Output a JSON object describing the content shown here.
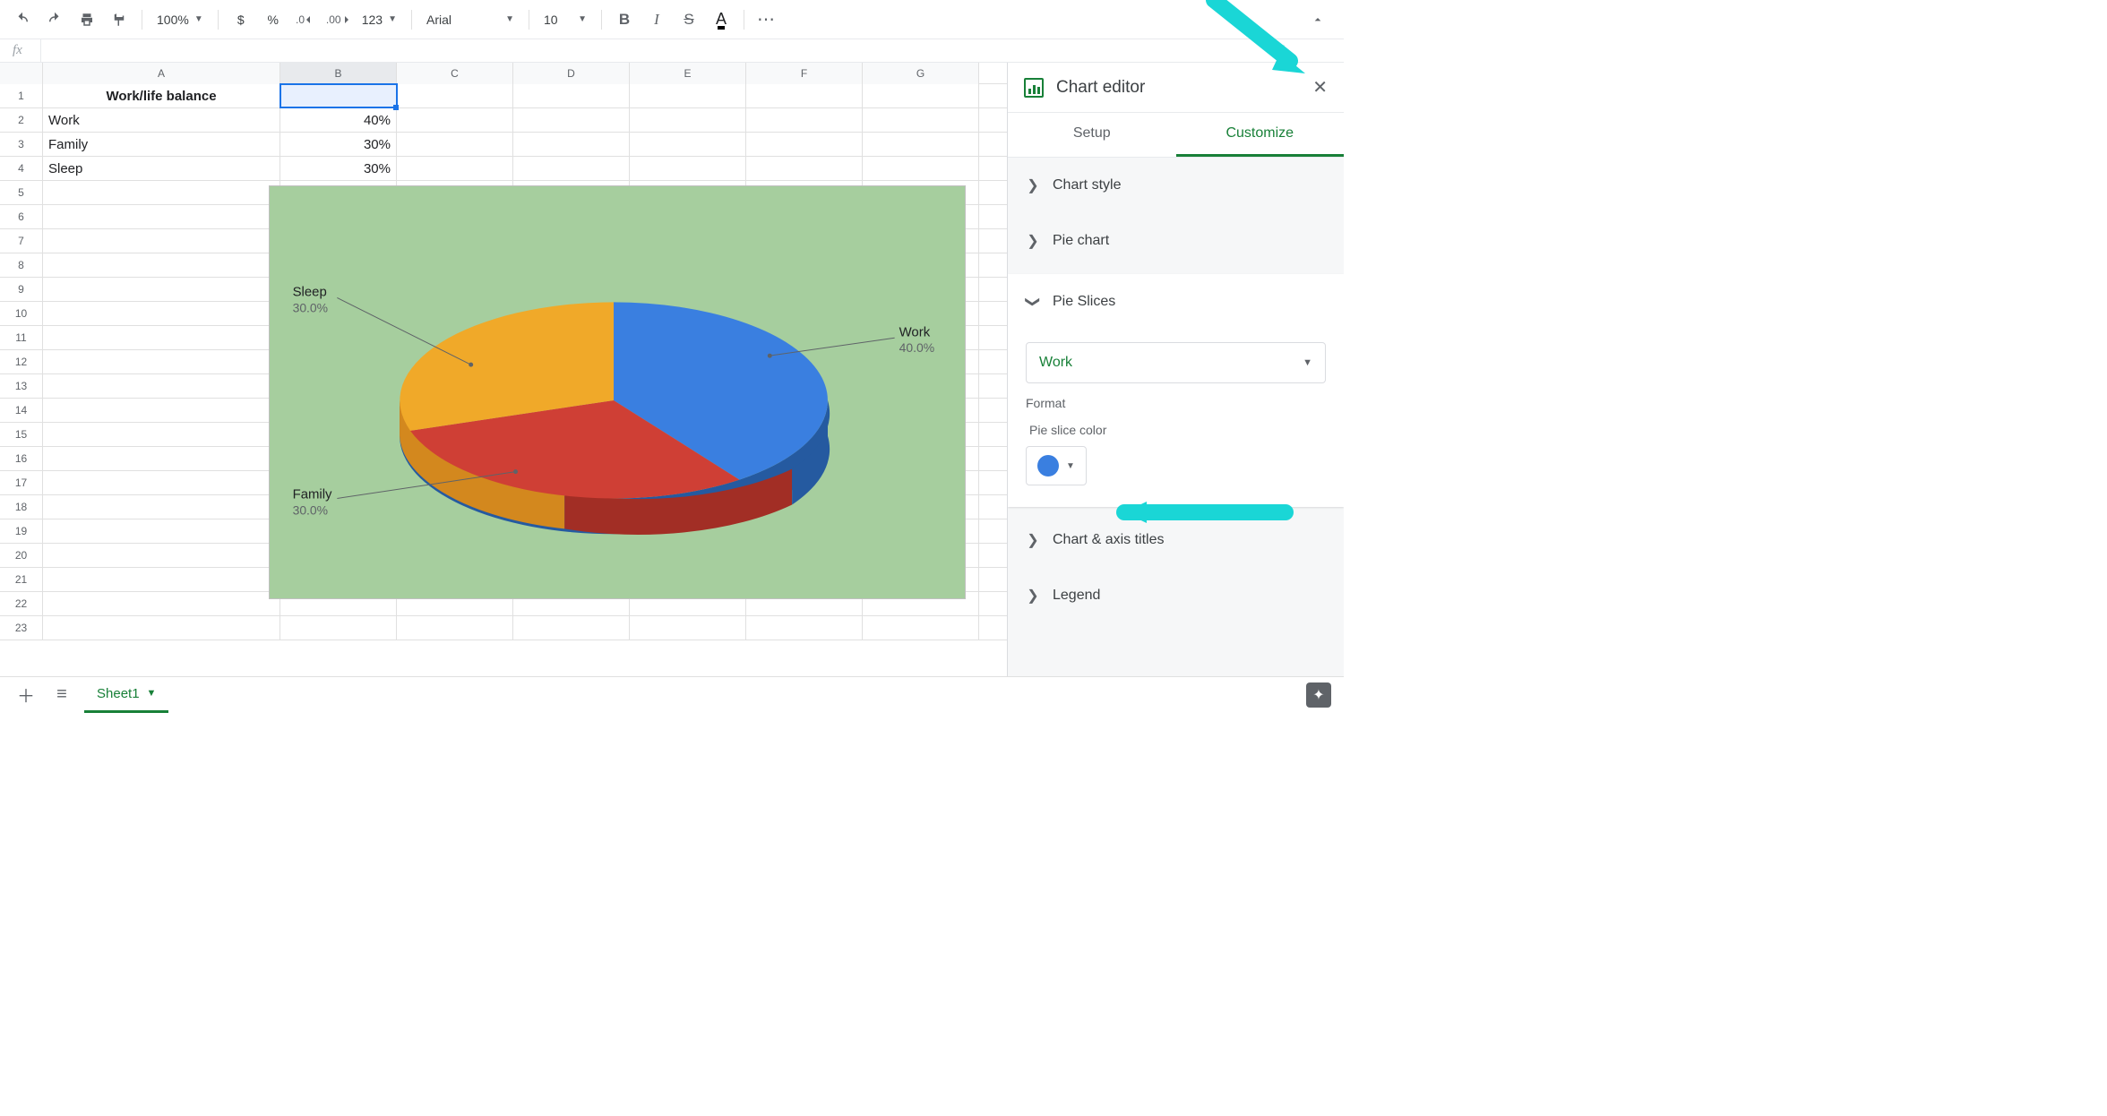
{
  "toolbar": {
    "zoom": "100%",
    "font": "Arial",
    "font_size": "10",
    "fmt_123": "123",
    "currency_symbol": "$",
    "percent_symbol": "%"
  },
  "fx_label": "fx",
  "columns": [
    "A",
    "B",
    "C",
    "D",
    "E",
    "F",
    "G"
  ],
  "row_count": 23,
  "cells": {
    "A1": "Work/life balance",
    "A2": "Work",
    "B2": "40%",
    "A3": "Family",
    "B3": "30%",
    "A4": "Sleep",
    "B4": "30%"
  },
  "active_cell": "B1",
  "chart_data": {
    "type": "pie",
    "title": "",
    "series": [
      {
        "name": "Work",
        "value": 40.0,
        "label": "40.0%",
        "color": "#3a7fe0"
      },
      {
        "name": "Family",
        "value": 30.0,
        "label": "30.0%",
        "color": "#cf3f35"
      },
      {
        "name": "Sleep",
        "value": 30.0,
        "label": "30.0%",
        "color": "#f0a929"
      }
    ],
    "background": "#a6ce9e",
    "style_3d": true
  },
  "side_panel": {
    "title": "Chart editor",
    "tabs": {
      "setup": "Setup",
      "customize": "Customize",
      "active": "customize"
    },
    "sections": {
      "chart_style": "Chart style",
      "pie_chart": "Pie chart",
      "pie_slices": "Pie Slices",
      "chart_axis": "Chart & axis titles",
      "legend": "Legend"
    },
    "pie_slices": {
      "selected_slice": "Work",
      "format_label": "Format",
      "color_label": "Pie slice color",
      "selected_color": "#3a7fe0"
    }
  },
  "footer": {
    "sheet_name": "Sheet1"
  }
}
